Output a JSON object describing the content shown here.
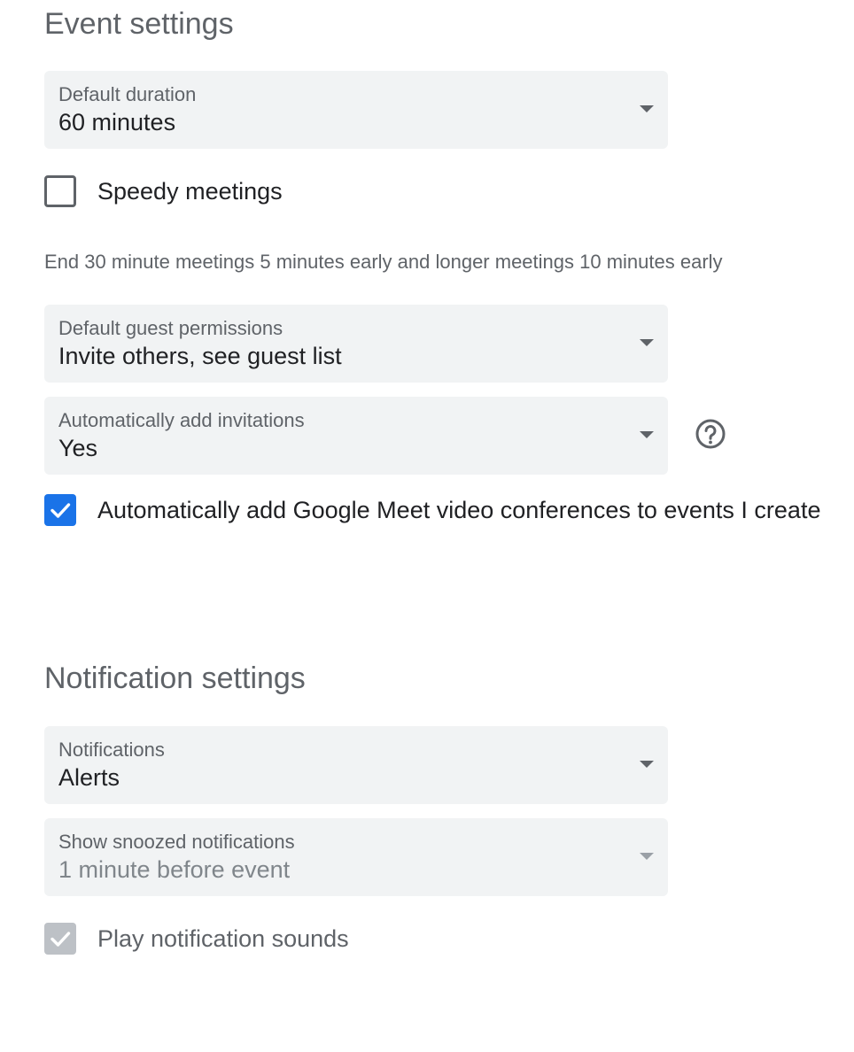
{
  "event_settings": {
    "title": "Event settings",
    "default_duration": {
      "label": "Default duration",
      "value": "60 minutes"
    },
    "speedy_meetings": {
      "label": "Speedy meetings",
      "checked": false,
      "helper": "End 30 minute meetings 5 minutes early and longer meetings 10 minutes early"
    },
    "guest_permissions": {
      "label": "Default guest permissions",
      "value": "Invite others, see guest list"
    },
    "auto_add_invitations": {
      "label": "Automatically add invitations",
      "value": "Yes",
      "help_icon": "help-circle-icon"
    },
    "google_meet": {
      "label": "Automatically add Google Meet video conferences to events I create",
      "checked": true
    }
  },
  "notification_settings": {
    "title": "Notification settings",
    "notifications": {
      "label": "Notifications",
      "value": "Alerts"
    },
    "snoozed": {
      "label": "Show snoozed notifications",
      "value": "1 minute before event",
      "disabled": true
    },
    "sounds": {
      "label": "Play notification sounds",
      "checked": true,
      "disabled": true
    }
  },
  "colors": {
    "accent": "#1a73e8",
    "field_bg": "#f1f3f4",
    "secondary_text": "#5f6368"
  }
}
